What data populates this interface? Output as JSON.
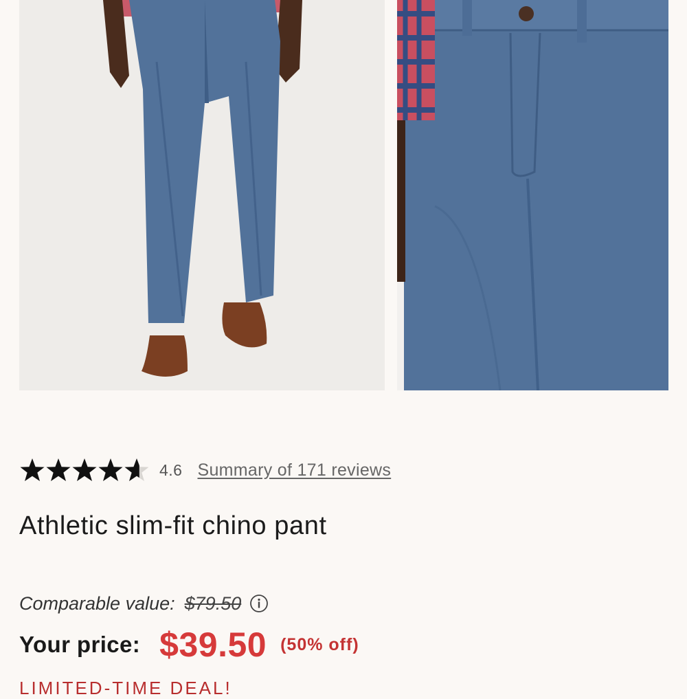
{
  "product": {
    "rating": "4.6",
    "rating_stars": 4.6,
    "reviews_link": "Summary of 171 reviews",
    "title": "Athletic slim-fit chino pant"
  },
  "pricing": {
    "comparable_label": "Comparable value:",
    "comparable_value": "$79.50",
    "price_label": "Your price:",
    "price_value": "$39.50",
    "discount": "(50% off)",
    "deal_banner": "LIMITED-TIME DEAL!"
  },
  "colors": {
    "background": "#fbf8f5",
    "price_red": "#d63a3a",
    "pant_blue": "#52729a",
    "star": "#111111"
  },
  "icons": [
    "star-icon",
    "info-icon"
  ]
}
